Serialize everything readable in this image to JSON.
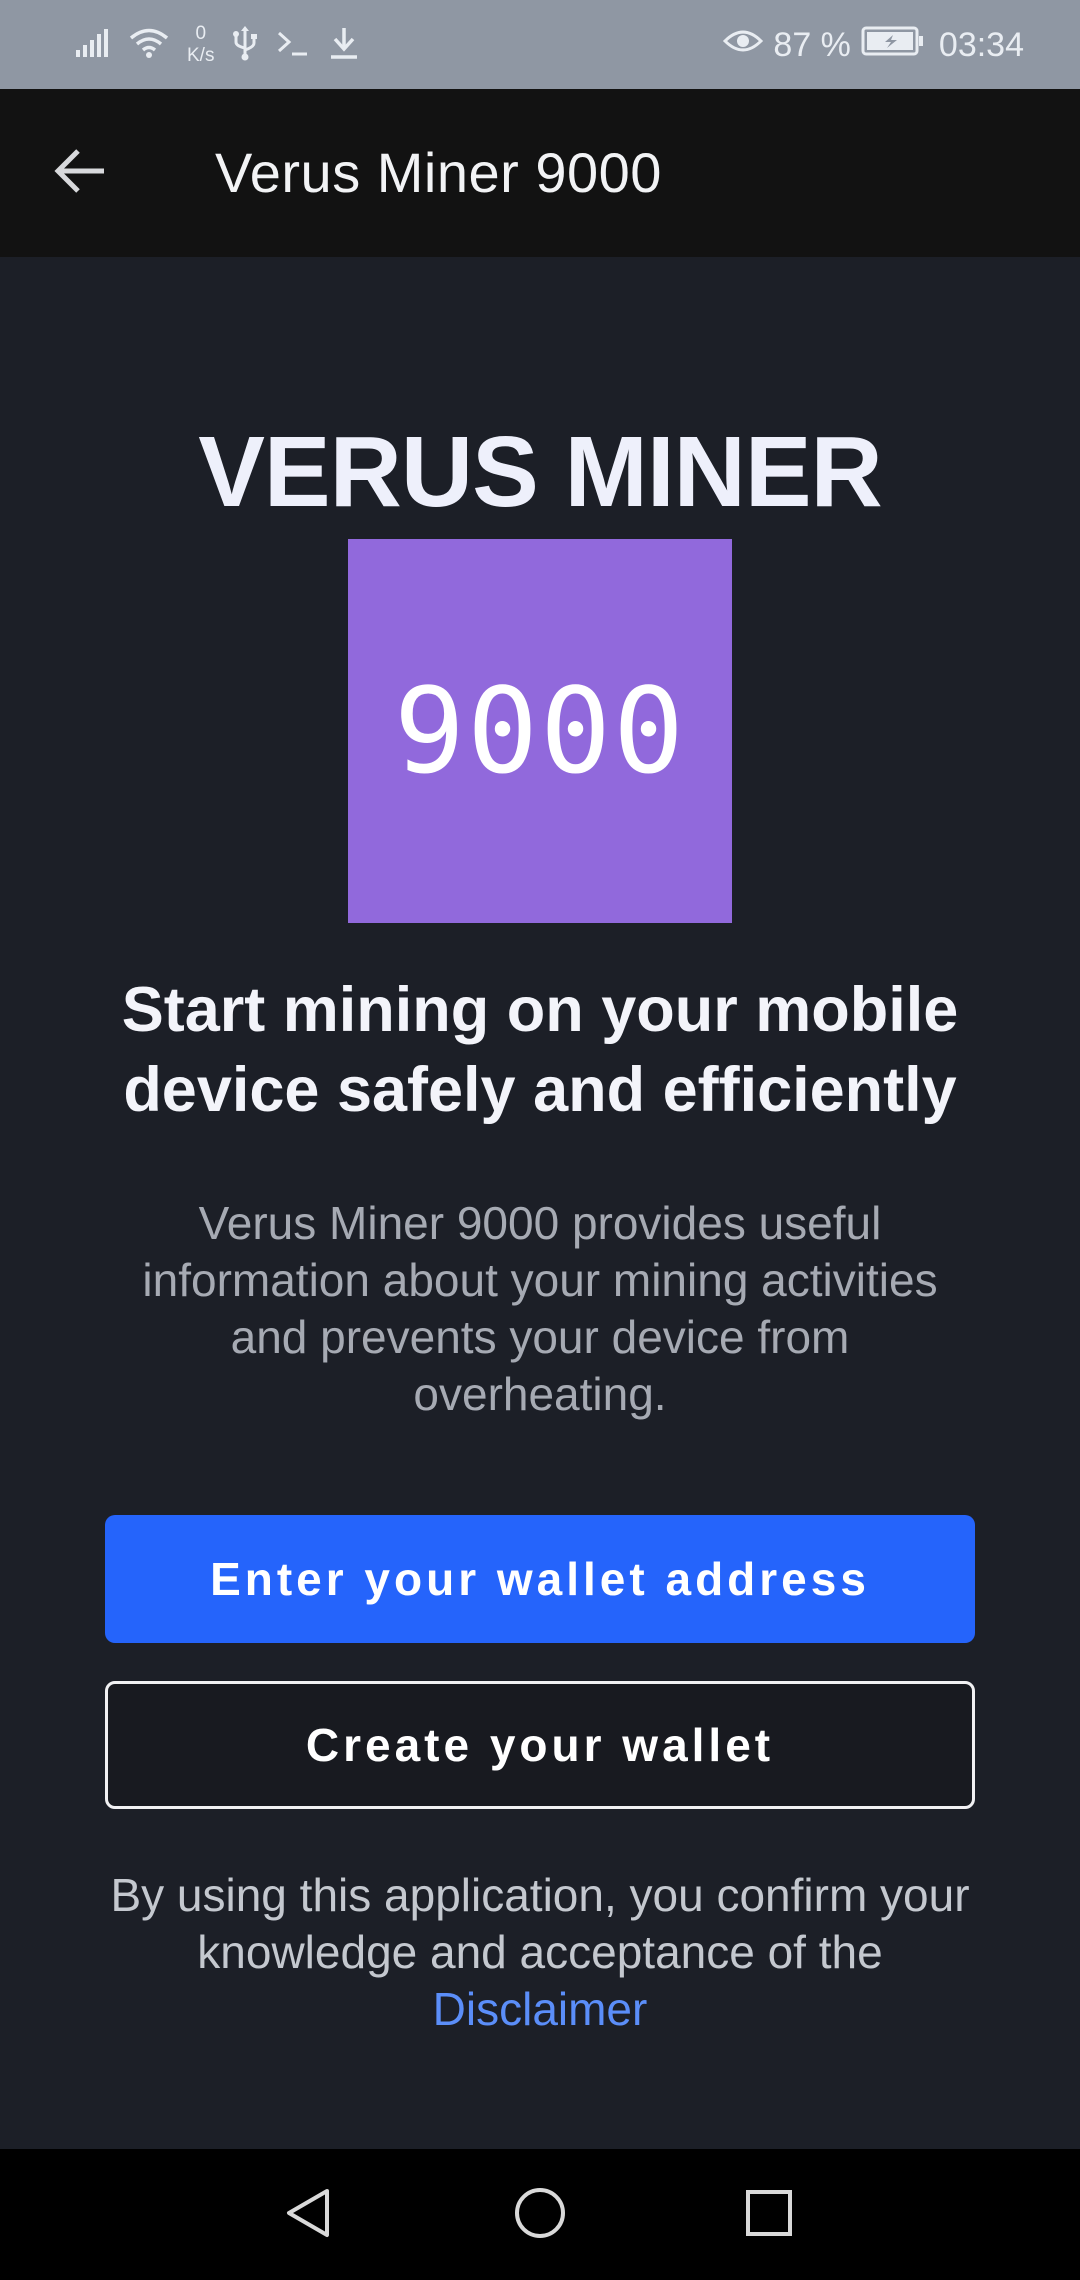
{
  "status_bar": {
    "net_speed_value": "0",
    "net_speed_unit": "K/s",
    "battery": "87 %",
    "time": "03:34",
    "icons": [
      "signal-icon",
      "wifi-icon",
      "usb-icon",
      "terminal-icon",
      "download-icon",
      "eye-icon",
      "battery-icon"
    ]
  },
  "app_bar": {
    "title": "Verus Miner 9000",
    "back_icon": "arrow-left-icon"
  },
  "main": {
    "hero_title": "VERUS MINER",
    "logo_text": "9000",
    "logo_color": "#9169dc",
    "headline": "Start mining on your mobile device safely and efficiently",
    "description": "Verus Miner 9000 provides useful information about your mining activities and prevents your device from overheating.",
    "primary_button": "Enter your wallet address",
    "secondary_button": "Create your wallet",
    "disclaimer_text": "By using this application, you confirm your knowledge and acceptance of the",
    "disclaimer_link": "Disclaimer"
  },
  "nav_bar": {
    "icons": [
      "back-triangle-icon",
      "home-circle-icon",
      "recents-square-icon"
    ]
  },
  "colors": {
    "accent": "#2564fb",
    "link": "#5b8ef9",
    "background": "#1c1f27",
    "app_bar": "#121212",
    "status_bar": "#8f97a3"
  }
}
